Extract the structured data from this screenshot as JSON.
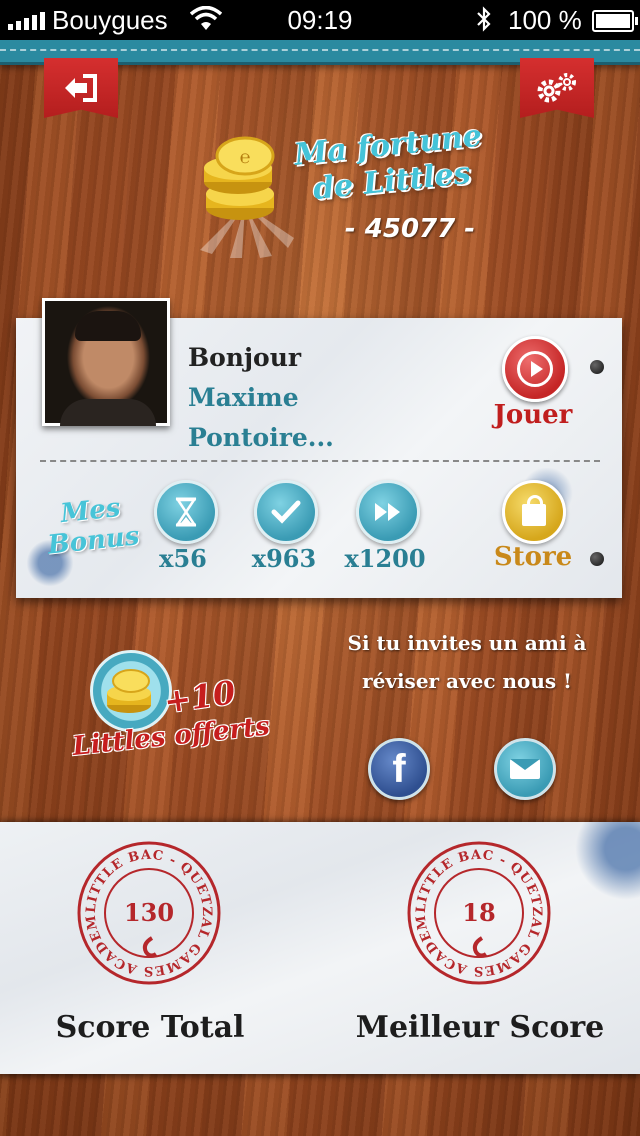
{
  "status_bar": {
    "carrier": "Bouygues",
    "time": "09:19",
    "battery": "100 %"
  },
  "header": {
    "back_icon": "exit-icon",
    "settings_icon": "gears-icon"
  },
  "fortune": {
    "title_line1": "Ma fortune",
    "title_line2": "de Littles",
    "value": "- 45077 -"
  },
  "profile": {
    "greeting": "Bonjour",
    "first_name": "Maxime",
    "last_name": "Pontoire...",
    "play_label": "Jouer"
  },
  "bonus": {
    "title_line1": "Mes",
    "title_line2": "Bonus",
    "items": [
      {
        "icon": "hourglass-icon",
        "count": "x56"
      },
      {
        "icon": "check-icon",
        "count": "x963"
      },
      {
        "icon": "fast-forward-icon",
        "count": "x1200"
      }
    ],
    "store_label": "Store"
  },
  "invite": {
    "bonus_amount": "+10",
    "bonus_label": "Littles offerts",
    "text_line1": "Si tu invites un ami à",
    "text_line2": "réviser avec nous !"
  },
  "scores": {
    "stamp_text": "LITTLE BAC - QUETZAL GAMES ACADEMY",
    "total_value": "130",
    "total_label": "Score Total",
    "best_value": "18",
    "best_label": "Meilleur Score"
  },
  "colors": {
    "teal": "#2a7f93",
    "red": "#c01e1e",
    "gold": "#c9891a"
  }
}
